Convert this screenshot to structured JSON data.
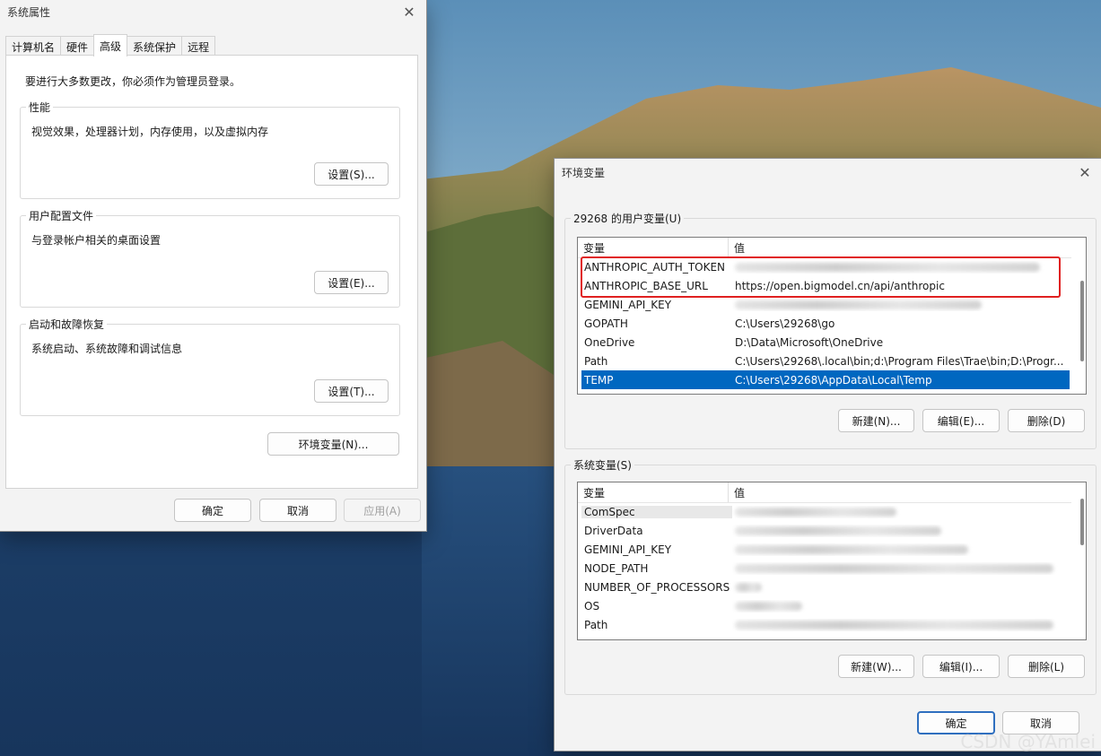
{
  "sysprops": {
    "title": "系统属性",
    "tabs": [
      "计算机名",
      "硬件",
      "高级",
      "系统保护",
      "远程"
    ],
    "admin_note": "要进行大多数更改，你必须作为管理员登录。",
    "performance": {
      "label": "性能",
      "desc": "视觉效果，处理器计划，内存使用，以及虚拟内存",
      "button": "设置(S)..."
    },
    "profiles": {
      "label": "用户配置文件",
      "desc": "与登录帐户相关的桌面设置",
      "button": "设置(E)..."
    },
    "startup": {
      "label": "启动和故障恢复",
      "desc": "系统启动、系统故障和调试信息",
      "button": "设置(T)..."
    },
    "env_button": "环境变量(N)...",
    "ok": "确定",
    "cancel": "取消",
    "apply": "应用(A)"
  },
  "envvars": {
    "title": "环境变量",
    "user_group": "29268 的用户变量(U)",
    "system_group": "系统变量(S)",
    "col_name": "变量",
    "col_value": "值",
    "user_rows": [
      {
        "name": "ANTHROPIC_AUTH_TOKEN",
        "value": ""
      },
      {
        "name": "ANTHROPIC_BASE_URL",
        "value": "https://open.bigmodel.cn/api/anthropic"
      },
      {
        "name": "GEMINI_API_KEY",
        "value": ""
      },
      {
        "name": "GOPATH",
        "value": "C:\\Users\\29268\\go"
      },
      {
        "name": "OneDrive",
        "value": "D:\\Data\\Microsoft\\OneDrive"
      },
      {
        "name": "Path",
        "value": "C:\\Users\\29268\\.local\\bin;d:\\Program Files\\Trae\\bin;D:\\Progr..."
      },
      {
        "name": "TEMP",
        "value": "C:\\Users\\29268\\AppData\\Local\\Temp"
      }
    ],
    "system_rows": [
      {
        "name": "ComSpec"
      },
      {
        "name": "DriverData"
      },
      {
        "name": "GEMINI_API_KEY"
      },
      {
        "name": "NODE_PATH"
      },
      {
        "name": "NUMBER_OF_PROCESSORS"
      },
      {
        "name": "OS"
      },
      {
        "name": "Path"
      }
    ],
    "user_buttons": {
      "new": "新建(N)...",
      "edit": "编辑(E)...",
      "delete": "删除(D)"
    },
    "system_buttons": {
      "new": "新建(W)...",
      "edit": "编辑(I)...",
      "delete": "删除(L)"
    },
    "ok": "确定",
    "cancel": "取消"
  },
  "watermark": "CSDN @YAmlei",
  "colors": {
    "selection": "#0067c0",
    "highlight_box": "#e02020",
    "primary_border": "#2f6fbf"
  }
}
